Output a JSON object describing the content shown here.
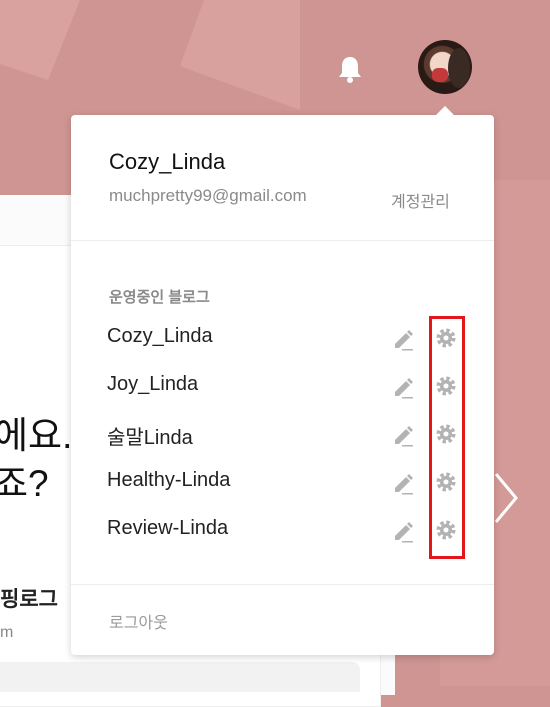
{
  "background": {
    "headline_line1": "에요.",
    "headline_line2": "죠?",
    "subtitle": "핑로그",
    "url_fragment": "m"
  },
  "header": {
    "bell_icon": "bell-icon",
    "avatar_icon": "avatar"
  },
  "account": {
    "name": "Cozy_Linda",
    "email": "muchpretty99@gmail.com",
    "manage_label": "계정관리"
  },
  "blogs": {
    "section_title": "운영중인 블로그",
    "items": [
      {
        "label": "Cozy_Linda"
      },
      {
        "label": "Joy_Linda"
      },
      {
        "label": "술말Linda"
      },
      {
        "label": "Healthy-Linda"
      },
      {
        "label": "Review-Linda"
      }
    ]
  },
  "logout_label": "로그아웃",
  "colors": {
    "background": "#cf9592",
    "highlight": "#e3161c",
    "icon_gray": "#b3b3b3"
  }
}
